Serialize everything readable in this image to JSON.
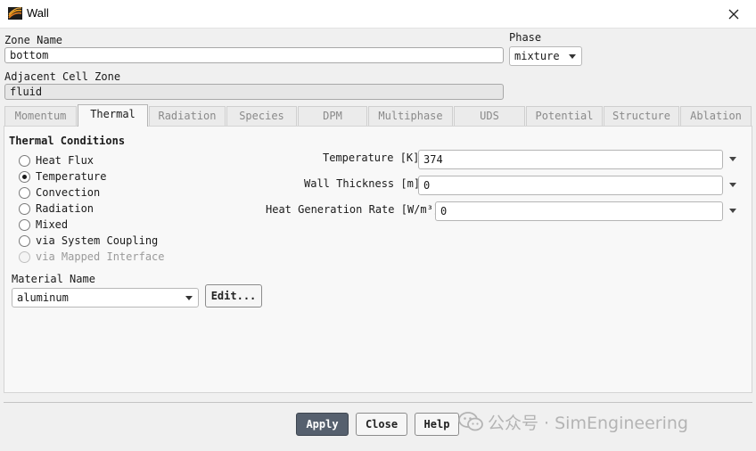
{
  "window": {
    "title": "Wall"
  },
  "zone_name": {
    "label": "Zone Name",
    "value": "bottom"
  },
  "phase": {
    "label": "Phase",
    "value": "mixture"
  },
  "adjacent_cell_zone": {
    "label": "Adjacent Cell Zone",
    "value": "fluid"
  },
  "tabs": [
    {
      "label": "Momentum",
      "active": false
    },
    {
      "label": "Thermal",
      "active": true
    },
    {
      "label": "Radiation",
      "active": false
    },
    {
      "label": "Species",
      "active": false
    },
    {
      "label": "DPM",
      "active": false
    },
    {
      "label": "Multiphase",
      "active": false
    },
    {
      "label": "UDS",
      "active": false
    },
    {
      "label": "Potential",
      "active": false
    },
    {
      "label": "Structure",
      "active": false
    },
    {
      "label": "Ablation",
      "active": false
    }
  ],
  "thermal": {
    "heading": "Thermal Conditions",
    "options": [
      {
        "label": "Heat Flux",
        "selected": false,
        "enabled": true
      },
      {
        "label": "Temperature",
        "selected": true,
        "enabled": true
      },
      {
        "label": "Convection",
        "selected": false,
        "enabled": true
      },
      {
        "label": "Radiation",
        "selected": false,
        "enabled": true
      },
      {
        "label": "Mixed",
        "selected": false,
        "enabled": true
      },
      {
        "label": "via System Coupling",
        "selected": false,
        "enabled": true
      },
      {
        "label": "via Mapped Interface",
        "selected": false,
        "enabled": false
      }
    ],
    "temperature": {
      "label": "Temperature [K]",
      "value": "374"
    },
    "wall_thickness": {
      "label": "Wall Thickness [m]",
      "value": "0"
    },
    "heat_generation_rate": {
      "label": "Heat Generation Rate [W/m³]",
      "value": "0"
    },
    "material": {
      "label": "Material Name",
      "value": "aluminum",
      "edit_label": "Edit..."
    }
  },
  "buttons": {
    "apply": "Apply",
    "close": "Close",
    "help": "Help"
  },
  "watermark": {
    "text": "公众号 · SimEngineering"
  }
}
